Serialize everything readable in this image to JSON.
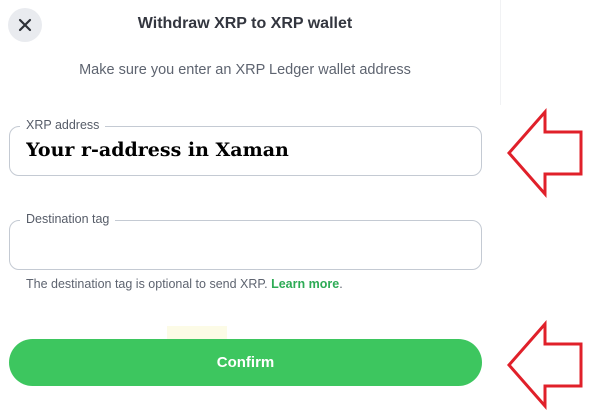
{
  "dialog": {
    "title": "Withdraw XRP to XRP wallet",
    "subtitle": "Make sure you enter an XRP Ledger wallet address",
    "close_icon": "close-icon"
  },
  "form": {
    "address_label": "XRP address",
    "address_value": "Your r-address in Xaman",
    "destination_label": "Destination tag",
    "destination_value": "",
    "hint_text": "The destination tag is optional to send XRP.",
    "learn_more_label": "Learn more",
    "hint_period": "."
  },
  "confirm": {
    "label": "Confirm"
  },
  "annotations": {
    "arrow_icon": "left-arrow-icon",
    "arrow_color": "#e0202a"
  },
  "colors": {
    "accent_green": "#3dc65f",
    "link_green": "#2dab55",
    "title_text": "#33363f",
    "border": "#c4cad3"
  }
}
